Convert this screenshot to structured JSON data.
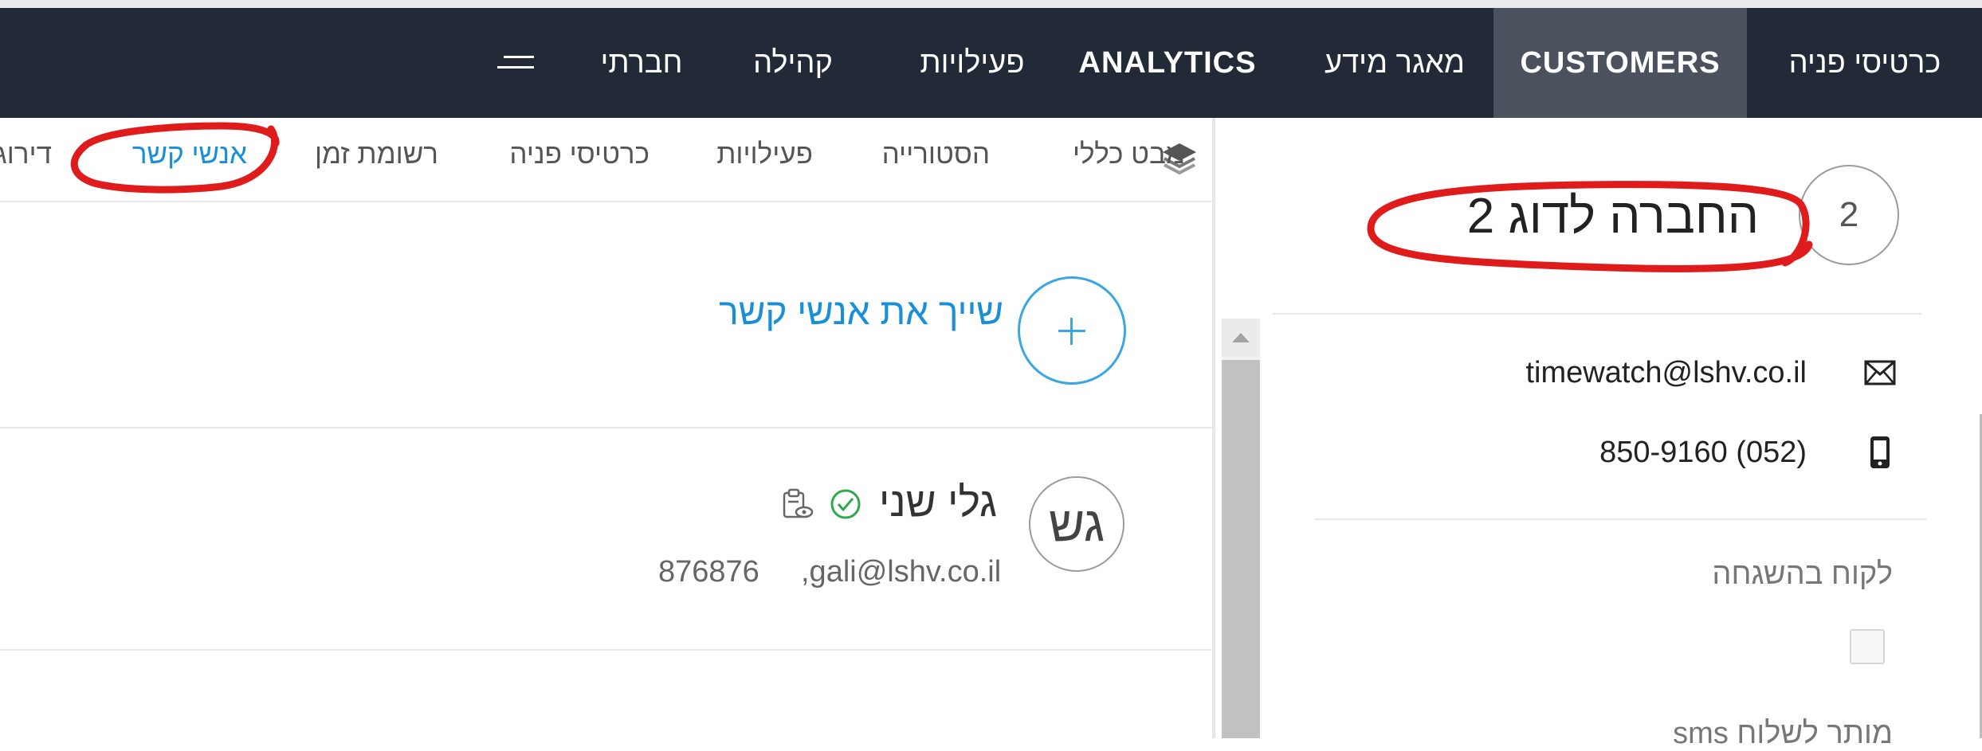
{
  "nav": {
    "items": [
      {
        "label": "כרטיסי פניה"
      },
      {
        "label": "CUSTOMERS"
      },
      {
        "label": "מאגר מידע"
      },
      {
        "label": "ANALYTICS"
      },
      {
        "label": "פעילויות"
      },
      {
        "label": "קהילה"
      },
      {
        "label": "חברתי"
      }
    ],
    "menu_icon": "hamburger-icon",
    "active_index": 1
  },
  "company": {
    "avatar_label": "2",
    "name": "החברה לדוג 2",
    "email": "timewatch@lshv.co.il",
    "phone": "850-9160 (052)",
    "email_icon": "envelope-icon",
    "phone_icon": "mobile-phone-icon",
    "fields": {
      "managed_label": "לקוח בהשגחה",
      "sms_label": "מותר לשלוח sms"
    }
  },
  "tabs": [
    {
      "label": "מבט כללי"
    },
    {
      "label": "הסטורייה"
    },
    {
      "label": "פעילויות"
    },
    {
      "label": "כרטיסי פניה"
    },
    {
      "label": "רשומת זמן"
    },
    {
      "label": "אנשי קשר"
    },
    {
      "label": "דירוג"
    }
  ],
  "tabs_icon": "layers-icon",
  "active_tab": "אנשי קשר",
  "contacts": {
    "assign_label": "שייך את אנשי קשר",
    "items": [
      {
        "initials": "גש",
        "name": "גלי שני",
        "email": ",gali@lshv.co.il",
        "phone": "876876",
        "verified_icon": "check-circle-icon",
        "view_icon": "clipboard-eye-icon"
      }
    ]
  },
  "colors": {
    "nav_bg": "#212a36",
    "nav_active_bg": "#4b525e",
    "accent_blue": "#1a8fd7",
    "verified_green": "#2fa84f",
    "annotation_red": "#e01b1b"
  }
}
